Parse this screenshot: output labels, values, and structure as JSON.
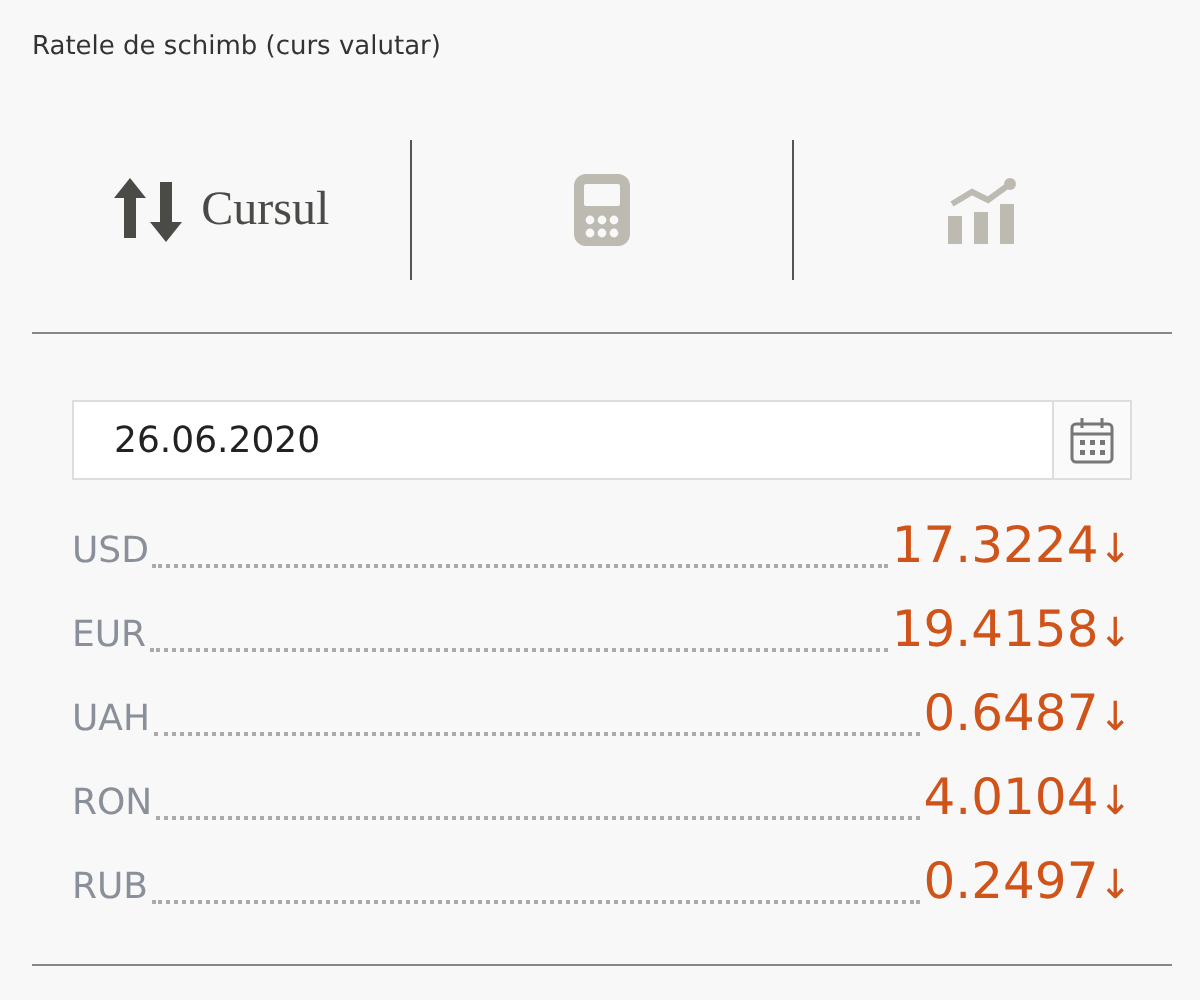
{
  "title": "Ratele de schimb (curs valutar)",
  "tabs": [
    {
      "kind": "rates",
      "label": "Cursul",
      "selected": true
    },
    {
      "kind": "calculator",
      "selected": false
    },
    {
      "kind": "chart",
      "selected": false
    }
  ],
  "date_field": {
    "value": "26.06.2020"
  },
  "rates": [
    {
      "currency": "USD",
      "value": "17.3224",
      "trend": "↓"
    },
    {
      "currency": "EUR",
      "value": "19.4158",
      "trend": "↓"
    },
    {
      "currency": "UAH",
      "value": "0.6487",
      "trend": "↓"
    },
    {
      "currency": "RON",
      "value": "4.0104",
      "trend": "↓"
    },
    {
      "currency": "RUB",
      "value": "0.2497",
      "trend": "↓"
    }
  ]
}
